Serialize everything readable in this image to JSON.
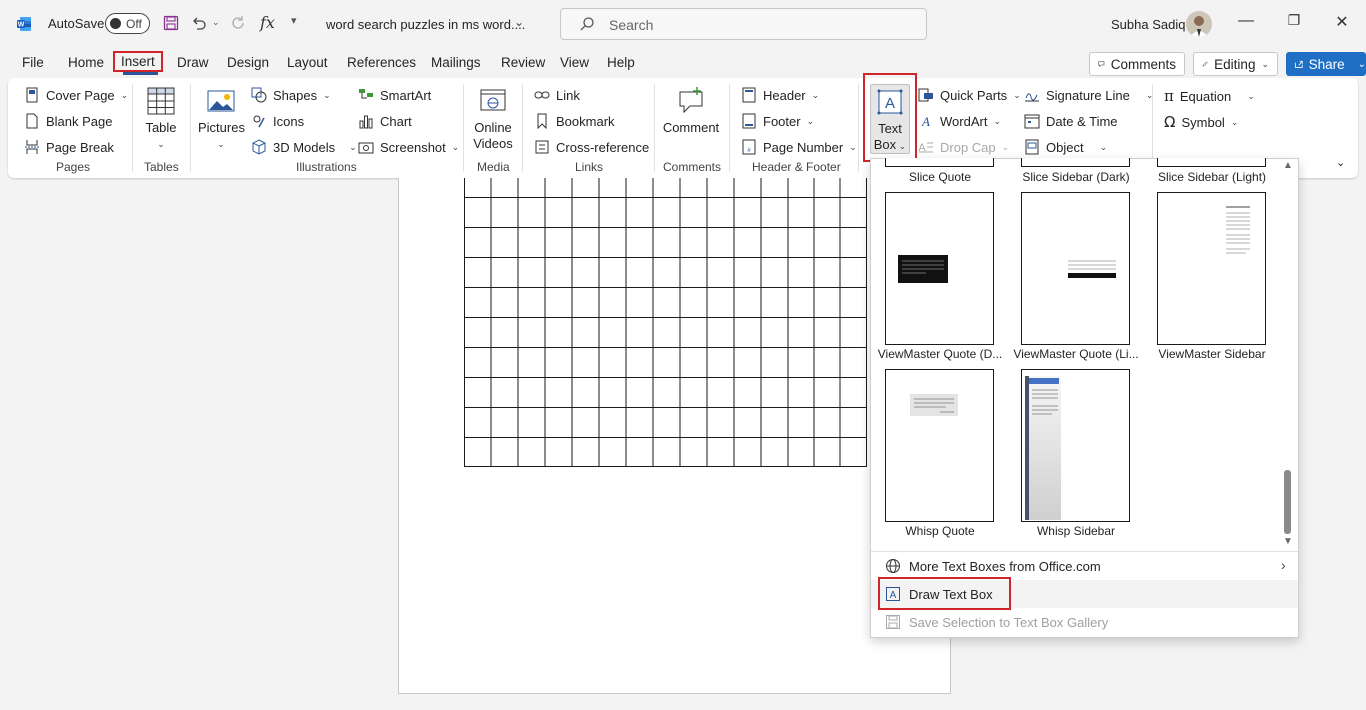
{
  "titlebar": {
    "autosave_label": "AutoSave",
    "toggle_state": "Off",
    "doc_title": "word search puzzles in ms word....",
    "search_placeholder": "Search",
    "user_name": "Subha Sadiq"
  },
  "menu": {
    "tabs": [
      "File",
      "Home",
      "Insert",
      "Draw",
      "Design",
      "Layout",
      "References",
      "Mailings",
      "Review",
      "View",
      "Help"
    ],
    "active_tab": "Insert",
    "comments_label": "Comments",
    "editing_label": "Editing",
    "share_label": "Share"
  },
  "ribbon": {
    "pages": {
      "items": [
        "Cover Page",
        "Blank Page",
        "Page Break"
      ],
      "label": "Pages"
    },
    "tables": {
      "button": "Table",
      "label": "Tables"
    },
    "illustrations": {
      "pictures": "Pictures",
      "items_left": [
        "Shapes",
        "Icons",
        "3D Models"
      ],
      "items_right": [
        "SmartArt",
        "Chart",
        "Screenshot"
      ],
      "label": "Illustrations"
    },
    "media": {
      "button_line1": "Online",
      "button_line2": "Videos",
      "label": "Media"
    },
    "links": {
      "items": [
        "Link",
        "Bookmark",
        "Cross-reference"
      ],
      "label": "Links"
    },
    "comments": {
      "button": "Comment",
      "label": "Comments"
    },
    "header_footer": {
      "items": [
        "Header",
        "Footer",
        "Page Number"
      ],
      "label": "Header & Footer"
    },
    "text": {
      "textbox_line1": "Text",
      "textbox_line2": "Box",
      "col1": [
        "Quick Parts",
        "WordArt",
        "Drop Cap"
      ],
      "col2": [
        "Signature Line",
        "Date & Time",
        "Object"
      ]
    },
    "symbols": {
      "items": [
        "Equation",
        "Symbol"
      ]
    }
  },
  "gallery": {
    "top_labels": [
      "Slice Quote",
      "Slice Sidebar (Dark)",
      "Slice Sidebar (Light)"
    ],
    "row1": [
      "ViewMaster Quote (D...",
      "ViewMaster Quote (Li...",
      "ViewMaster Sidebar"
    ],
    "row2": [
      "Whisp Quote",
      "Whisp Sidebar"
    ],
    "menu": {
      "more": "More Text Boxes from Office.com",
      "draw": "Draw Text Box",
      "save": "Save Selection to Text Box Gallery"
    }
  },
  "colors": {
    "accent": "#2b579a",
    "highlight_red": "#d0242c",
    "share_blue": "#1f6fc5"
  }
}
